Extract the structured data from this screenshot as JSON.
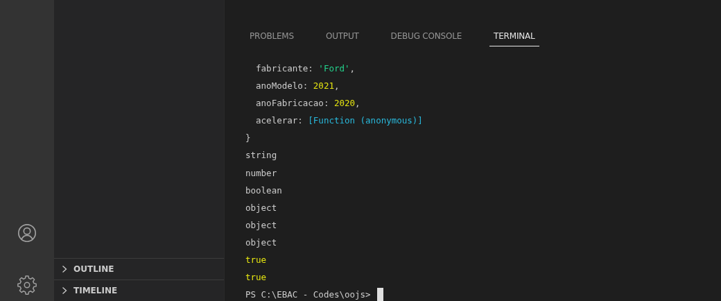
{
  "activity_bar": {
    "items": [
      {
        "kind": "account"
      },
      {
        "kind": "settings"
      }
    ]
  },
  "sidebar": {
    "sections": [
      {
        "label": "OUTLINE",
        "expanded": false
      },
      {
        "label": "TIMELINE",
        "expanded": false
      }
    ]
  },
  "panel": {
    "tabs": [
      {
        "label": "PROBLEMS",
        "selected": false
      },
      {
        "label": "OUTPUT",
        "selected": false
      },
      {
        "label": "DEBUG CONSOLE",
        "selected": false
      },
      {
        "label": "TERMINAL",
        "selected": true
      }
    ],
    "terminal": {
      "lines": [
        {
          "segments": [
            {
              "text": "  fabricante: ",
              "kind": "plain"
            },
            {
              "text": "'Ford'",
              "kind": "string"
            },
            {
              "text": ",",
              "kind": "plain"
            }
          ]
        },
        {
          "segments": [
            {
              "text": "  anoModelo: ",
              "kind": "plain"
            },
            {
              "text": "2021",
              "kind": "number"
            },
            {
              "text": ",",
              "kind": "plain"
            }
          ]
        },
        {
          "segments": [
            {
              "text": "  anoFabricacao: ",
              "kind": "plain"
            },
            {
              "text": "2020",
              "kind": "number"
            },
            {
              "text": ",",
              "kind": "plain"
            }
          ]
        },
        {
          "segments": [
            {
              "text": "  acelerar: ",
              "kind": "plain"
            },
            {
              "text": "[Function (anonymous)]",
              "kind": "function"
            }
          ]
        },
        {
          "segments": [
            {
              "text": "}",
              "kind": "plain"
            }
          ]
        },
        {
          "segments": [
            {
              "text": "string",
              "kind": "plain"
            }
          ]
        },
        {
          "segments": [
            {
              "text": "number",
              "kind": "plain"
            }
          ]
        },
        {
          "segments": [
            {
              "text": "boolean",
              "kind": "plain"
            }
          ]
        },
        {
          "segments": [
            {
              "text": "object",
              "kind": "plain"
            }
          ]
        },
        {
          "segments": [
            {
              "text": "object",
              "kind": "plain"
            }
          ]
        },
        {
          "segments": [
            {
              "text": "object",
              "kind": "plain"
            }
          ]
        },
        {
          "segments": [
            {
              "text": "true",
              "kind": "number"
            }
          ]
        },
        {
          "segments": [
            {
              "text": "true",
              "kind": "number"
            }
          ]
        }
      ],
      "prompt": "PS C:\\EBAC - Codes\\oojs>",
      "cursor": true
    }
  }
}
